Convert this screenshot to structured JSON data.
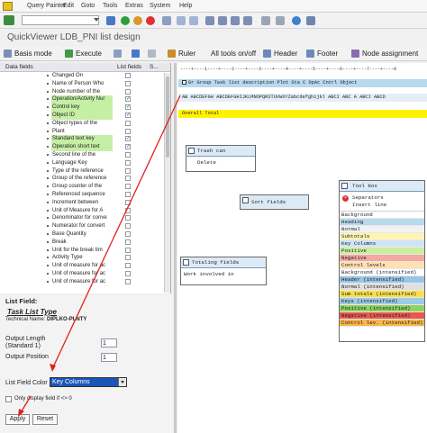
{
  "menu": {
    "items": [
      "Query Painter",
      "Edit",
      "Goto",
      "Tools",
      "Extras",
      "System",
      "Help"
    ]
  },
  "window": {
    "title": "QuickViewer LDB_PNI list design"
  },
  "toolbar": {
    "basis_mode": "Basis mode",
    "execute": "Execute",
    "ruler": "Ruler",
    "all_tools_off": "All tools on/off",
    "header": "Header",
    "footer": "Footer",
    "node_assignment": "Node assignment"
  },
  "fields_table": {
    "col_data_fields": "Data fields",
    "col_list_fields": "List fields",
    "col_s": "S...",
    "rows": [
      {
        "label": "Changed On",
        "checked": false,
        "green": false
      },
      {
        "label": "Name of Person Who",
        "checked": false,
        "green": false
      },
      {
        "label": "Node number of the",
        "checked": false,
        "green": false
      },
      {
        "label": "Operation/Activity Nur",
        "checked": true,
        "green": true
      },
      {
        "label": "Control key",
        "checked": true,
        "green": true
      },
      {
        "label": "Object ID",
        "checked": true,
        "green": true
      },
      {
        "label": "Object types of the",
        "checked": false,
        "green": false
      },
      {
        "label": "Plant",
        "checked": false,
        "green": false
      },
      {
        "label": "Standard text key",
        "checked": true,
        "green": true
      },
      {
        "label": "Operation short text",
        "checked": true,
        "green": true
      },
      {
        "label": "Second line of the",
        "checked": false,
        "green": false
      },
      {
        "label": "Language Key",
        "checked": false,
        "green": false
      },
      {
        "label": "Type of the reference",
        "checked": false,
        "green": false
      },
      {
        "label": "Group of the reference",
        "checked": false,
        "green": false
      },
      {
        "label": "Group counter of the",
        "checked": false,
        "green": false
      },
      {
        "label": "Referenced sequence",
        "checked": false,
        "green": false
      },
      {
        "label": "Increment between",
        "checked": false,
        "green": false
      },
      {
        "label": "Unit of Measure for A",
        "checked": false,
        "green": false
      },
      {
        "label": "Denominator for conve",
        "checked": false,
        "green": false
      },
      {
        "label": "Numerator for convert",
        "checked": false,
        "green": false
      },
      {
        "label": "Base Quantity",
        "checked": false,
        "green": false
      },
      {
        "label": "Break",
        "checked": false,
        "green": false
      },
      {
        "label": "Unit for the break tim",
        "checked": false,
        "green": false
      },
      {
        "label": "Activity Type",
        "checked": false,
        "green": false
      },
      {
        "label": "Unit of measure for ac",
        "checked": false,
        "green": false
      },
      {
        "label": "Unit of measure for ac",
        "checked": false,
        "green": false
      },
      {
        "label": "Unit of measure for ac",
        "checked": false,
        "green": false
      }
    ]
  },
  "list_field": {
    "heading": "List Field:",
    "field_title": "Task List Type",
    "tech_label": "Technical Name:",
    "tech_name": "DIPLKO-PLNTY",
    "output_length_label": "Output Length",
    "output_length_sub": "(Standard 1)",
    "output_length_value": "1",
    "output_position_label": "Output Position",
    "output_position_value": "1",
    "color_label": "List Field Color",
    "color_value": "Key Columns",
    "only_display_label": "Only display field if <> 0",
    "apply": "Apply",
    "reset": "Reset"
  },
  "layout_pane": {
    "ruler_text": "----+----1----+----2----+----3----+----4----+----5----+----6----+----7----+----8",
    "header_row": "Gr Group    Task list description          Plnt Sta C OpAc Cntrl Object",
    "data_row": "AB ABCDEFGH ABCDEFGHIJKLMNOPQRSTUVWXYZabcdefghijkl ABCI ABC A ABCI ABCD",
    "overall_total": "Overall Total"
  },
  "trash_box": {
    "title": "Trash can",
    "item": "Delete"
  },
  "sort_box": {
    "title": "Sort fields"
  },
  "totaling_box": {
    "title": "Totaling fields",
    "item": "Work involved in"
  },
  "toolbox": {
    "title": "Tool box",
    "separators": "Separators",
    "insert_line": "Insert line",
    "items": [
      {
        "label": "Background",
        "color": "#ffffff"
      },
      {
        "label": "Heading",
        "color": "#b8d9ee"
      },
      {
        "label": "Normal",
        "color": "#f2f2f2"
      },
      {
        "label": "Subtotals",
        "color": "#fdf5b0"
      },
      {
        "label": "Key Columns",
        "color": "#cfe5f5"
      },
      {
        "label": "Positive",
        "color": "#c9ef9f"
      },
      {
        "label": "Negative",
        "color": "#f6a7a0"
      },
      {
        "label": "Control levels",
        "color": "#ffe0b0"
      },
      {
        "label": "Background (intensified)",
        "color": "#ffffff"
      },
      {
        "label": "Header (intensified)",
        "color": "#97c6e8"
      },
      {
        "label": "Normal (intensified)",
        "color": "#e0e0e0"
      },
      {
        "label": "Sum totals (intensified)",
        "color": "#fbe04a"
      },
      {
        "label": "Keys (intensified)",
        "color": "#9ecbe8"
      },
      {
        "label": "Positive (intensified)",
        "color": "#90d25a"
      },
      {
        "label": "Negative (intensified)",
        "color": "#e9574e"
      },
      {
        "label": "Control lev. (intensified)",
        "color": "#f7b64a"
      }
    ]
  },
  "colors": {
    "accent_arrow": "#e02020",
    "selected_field": "#1a56b8",
    "overall_total": "#fff200"
  }
}
